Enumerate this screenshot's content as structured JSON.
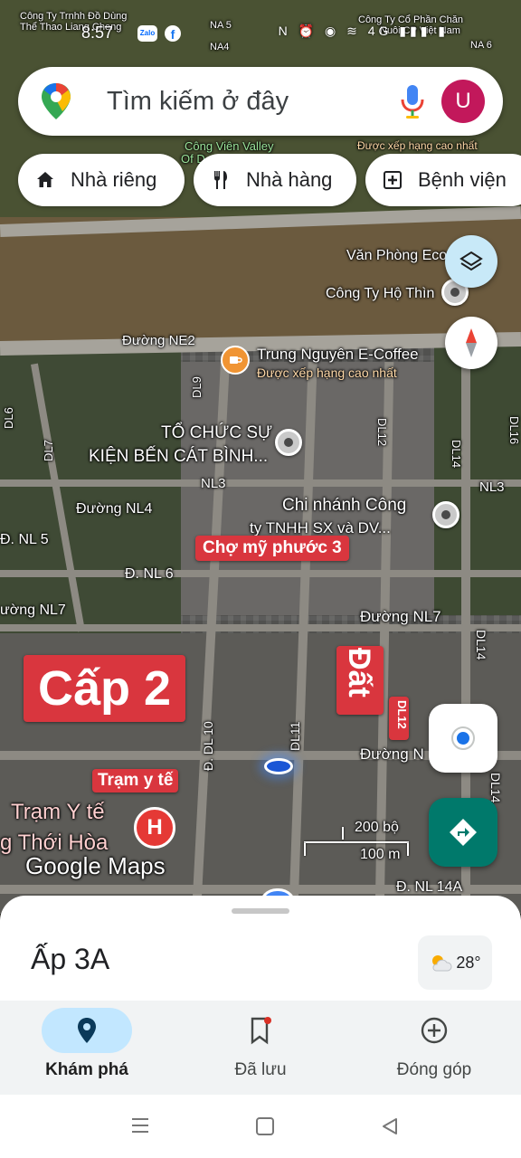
{
  "status_bar": {
    "time": "8:57",
    "icons": "N ⏰ ◉ ≋ 4G ▮▮▮ ▮"
  },
  "search": {
    "placeholder": "Tìm kiếm ở đây",
    "avatar_letter": "U"
  },
  "chips": [
    {
      "label": "Nhà riêng",
      "icon": "home-icon"
    },
    {
      "label": "Nhà hàng",
      "icon": "restaurant-icon"
    },
    {
      "label": "Bệnh viện",
      "icon": "hospital-icon"
    }
  ],
  "map": {
    "labels": {
      "cty_dodung": "Công Ty Trnhh Đồ Dùng",
      "cty_dodung2": "Thể Thao Liang Cheng",
      "cty_cophan": "Công Ty Cổ Phần Chăn",
      "cty_cophan2": "Nuôi CP Việt Nam",
      "na5": "NA 5",
      "na4": "NA4",
      "na6": "NA 6",
      "cong_vien": "Công Viên Valley",
      "cong_vien2": "Of D",
      "xep_hang_top": "Được xếp hạng cao nhất",
      "van_phong": "Văn Phòng Eco",
      "cty_ho_thin": "Công Ty Hộ Thìn",
      "duong_ne2": "Đường NE2",
      "trung_nguyen": "Trung Nguyên E-Coffee",
      "trung_nguyen_sub": "Được xếp hạng cao nhất",
      "dl9": "DL9",
      "to_chuc": "TỔ CHỨC SỰ",
      "to_chuc2": "KIỆN BẾN CÁT BÌNH...",
      "dl12_top": "DL12",
      "dl14_top": "DL14",
      "dl7": "DL7",
      "nl3_a": "NL3",
      "nl3_b": "NL3",
      "duong_nl4": "Đường NL4",
      "chi_nhanh": "Chi nhánh Công",
      "chi_nhanh2": "ty TNHH SX và DV...",
      "d_nl5": "Đ. NL 5",
      "d_nl6": "Đ. NL 6",
      "duong_nl7_left": "ường NL7",
      "duong_nl7_right": "Đường NL7",
      "dl14_mid": "DL14",
      "d_dl10": "Đ. DL 10",
      "dl11": "DL11",
      "dl12_red": "DL12",
      "duong_n": "Đường N",
      "dl14_bot": "DL14",
      "tram_y_te_big": "Trạm Y tế",
      "thoi_hoa": "g Thới Hòa",
      "google_maps": "Google Maps",
      "d_nl14a": "Đ. NL 14A",
      "dl16": "DL16",
      "dl6": "DL6"
    },
    "tags": {
      "cho_my_phuoc": "Chợ mỹ phước 3",
      "cap_2": "Cấp 2",
      "dat": "Đất",
      "tram_y_te": "Trạm y tế"
    },
    "scale": {
      "feet": "200 bộ",
      "meters": "100 m"
    }
  },
  "sheet": {
    "place_name": "Ấp 3A",
    "temperature": "28°"
  },
  "bottom_nav": [
    {
      "label": "Khám phá",
      "active": true
    },
    {
      "label": "Đã lưu",
      "active": false
    },
    {
      "label": "Đóng góp",
      "active": false
    }
  ],
  "colors": {
    "accent_blue": "#1a73e8",
    "tag_red": "#d9363e",
    "directions_teal": "#00796b",
    "avatar": "#c2185b",
    "nav_active": "#c2e7ff"
  }
}
